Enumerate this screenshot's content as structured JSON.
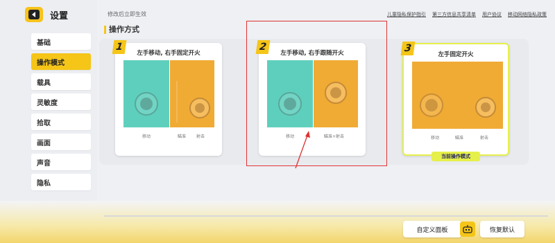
{
  "header": {
    "title": "设置",
    "hint": "修改后立即生效"
  },
  "top_links": [
    "儿童隐私保护指引",
    "第三方信息共享清单",
    "用户协议",
    "移动网络隐私政策"
  ],
  "sidebar": {
    "items": [
      {
        "label": "基础",
        "active": false
      },
      {
        "label": "操作模式",
        "active": true
      },
      {
        "label": "载具",
        "active": false
      },
      {
        "label": "灵敏度",
        "active": false
      },
      {
        "label": "拾取",
        "active": false
      },
      {
        "label": "画面",
        "active": false
      },
      {
        "label": "声音",
        "active": false
      },
      {
        "label": "隐私",
        "active": false
      }
    ]
  },
  "section": {
    "title": "操作方式"
  },
  "cards": [
    {
      "num": "1",
      "title": "左手移动, 右手固定开火",
      "labels": [
        "移动",
        "瞄准",
        "射击"
      ]
    },
    {
      "num": "2",
      "title": "左手移动, 右手跟随开火",
      "labels": [
        "移动",
        "瞄准+射击"
      ]
    },
    {
      "num": "3",
      "title": "左手固定开火",
      "labels": [
        "移动",
        "瞄准",
        "射击"
      ],
      "badge": "当前操作模式"
    }
  ],
  "footer": {
    "custom_panel": "自定义面板",
    "reset": "恢复默认"
  },
  "colors": {
    "accent": "#f5c518",
    "teal": "#5fcfbd",
    "orange": "#f0ab35",
    "highlight": "#e03131",
    "current_badge": "#e6f04a"
  }
}
